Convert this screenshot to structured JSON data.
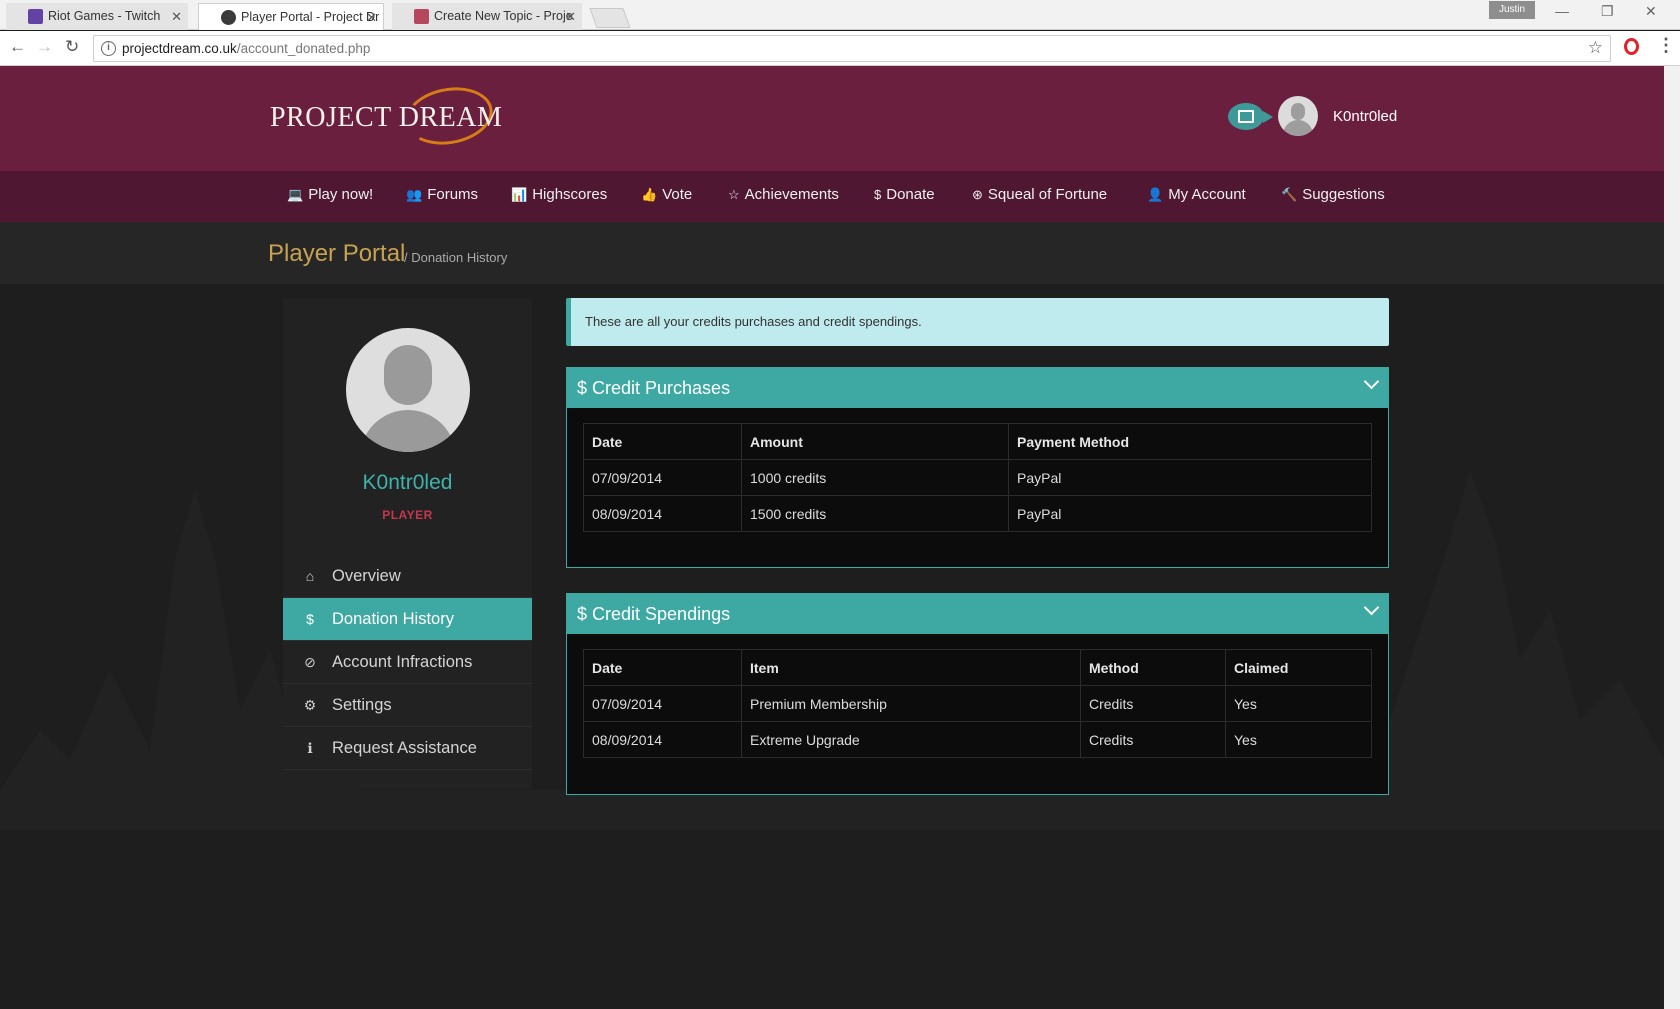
{
  "browser": {
    "tabs": [
      {
        "title": "Riot Games - Twitch",
        "fav_color": "#6441a4",
        "state": "inactive"
      },
      {
        "title": "Player Portal - Project Dr",
        "fav_color": "#3a3a3a",
        "state": "active"
      },
      {
        "title": "Create New Topic - Proje",
        "fav_color": "#b5485e",
        "state": "inactive"
      }
    ],
    "profile_chip": "Justin",
    "url_host": "projectdream.co.uk",
    "url_path": "/account_donated.php"
  },
  "header": {
    "logo_text": "PROJECT DREAM",
    "username": "K0ntr0led"
  },
  "nav": [
    {
      "label": "Play now!",
      "icon": "laptop-icon",
      "glyph": "💻"
    },
    {
      "label": "Forums",
      "icon": "users-icon",
      "glyph": "👥"
    },
    {
      "label": "Highscores",
      "icon": "bar-chart-icon",
      "glyph": "📊"
    },
    {
      "label": "Vote",
      "icon": "thumbs-up-icon",
      "glyph": "👍"
    },
    {
      "label": "Achievements",
      "icon": "star-icon",
      "glyph": "☆"
    },
    {
      "label": "Donate",
      "icon": "dollar-icon",
      "glyph": "$"
    },
    {
      "label": "Squeal of Fortune",
      "icon": "wheel-icon",
      "glyph": "⊛"
    },
    {
      "label": "My Account",
      "icon": "user-icon",
      "glyph": "👤"
    },
    {
      "label": "Suggestions",
      "icon": "gavel-icon",
      "glyph": "🔨"
    }
  ],
  "breadcrumb": {
    "title": "Player Portal",
    "current": "/ Donation History"
  },
  "sidebar": {
    "username": "K0ntr0led",
    "role": "PLAYER",
    "items": [
      {
        "label": "Overview",
        "icon": "home-icon",
        "glyph": "⌂",
        "active": false
      },
      {
        "label": "Donation History",
        "icon": "dollar-icon",
        "glyph": "$",
        "active": true
      },
      {
        "label": "Account Infractions",
        "icon": "ban-icon",
        "glyph": "⊘",
        "active": false
      },
      {
        "label": "Settings",
        "icon": "gear-icon",
        "glyph": "⚙",
        "active": false
      },
      {
        "label": "Request Assistance",
        "icon": "info-icon",
        "glyph": "ℹ",
        "active": false
      }
    ]
  },
  "alert": {
    "text": "These are all your credits purchases and credit spendings."
  },
  "purchases": {
    "title": "$ Credit Purchases",
    "columns": [
      "Date",
      "Amount",
      "Payment Method"
    ],
    "rows": [
      [
        "07/09/2014",
        "1000 credits",
        "PayPal"
      ],
      [
        "08/09/2014",
        "1500 credits",
        "PayPal"
      ]
    ]
  },
  "spendings": {
    "title": "$ Credit Spendings",
    "columns": [
      "Date",
      "Item",
      "Method",
      "Claimed"
    ],
    "rows": [
      [
        "07/09/2014",
        "Premium Membership",
        "Credits",
        "Yes"
      ],
      [
        "08/09/2014",
        "Extreme Upgrade",
        "Credits",
        "Yes"
      ]
    ]
  },
  "colors": {
    "header": "#6a1f3f",
    "nav": "#4f1732",
    "accent": "#3ea9a3",
    "gold": "#c7a351",
    "role": "#c4374d"
  }
}
